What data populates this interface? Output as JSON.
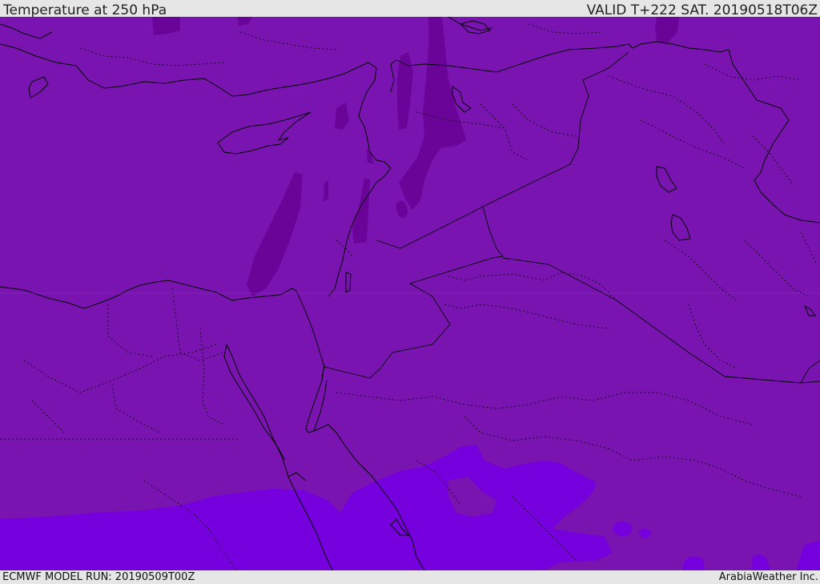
{
  "header": {
    "title": "Temperature at 250 hPa",
    "valid": "VALID T+222 SAT. 20190518T06Z"
  },
  "footer": {
    "model_run": "ECMWF MODEL RUN: 20190509T00Z",
    "credit": "ArabiaWeather Inc."
  },
  "colors": {
    "background_band": "#7914b0",
    "cold_band": "#6a0398",
    "warm_band": "#7600dd",
    "coastline": "#000000",
    "border": "#000000"
  }
}
